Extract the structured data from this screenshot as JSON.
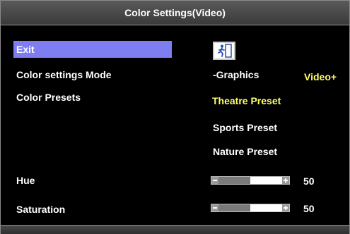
{
  "window": {
    "title": "Color Settings(Video)"
  },
  "menu": {
    "exit_label": "Exit",
    "color_mode_label": "Color settings Mode",
    "color_presets_label": "Color Presets",
    "hue_label": "Hue",
    "saturation_label": "Saturation"
  },
  "options": {
    "mode_graphics": "-Graphics",
    "mode_video": "Video+",
    "presets": [
      "Theatre Preset",
      "Sports Preset",
      "Nature Preset"
    ]
  },
  "hue": {
    "value": "50",
    "level": 0.5
  },
  "saturation": {
    "value": "50",
    "level": 0.5
  },
  "colors": {
    "highlight": "#7e7ef2",
    "selected_text": "#ffff6a",
    "background": "#000000"
  },
  "icons": {
    "exit": "running-man-exit-icon"
  }
}
